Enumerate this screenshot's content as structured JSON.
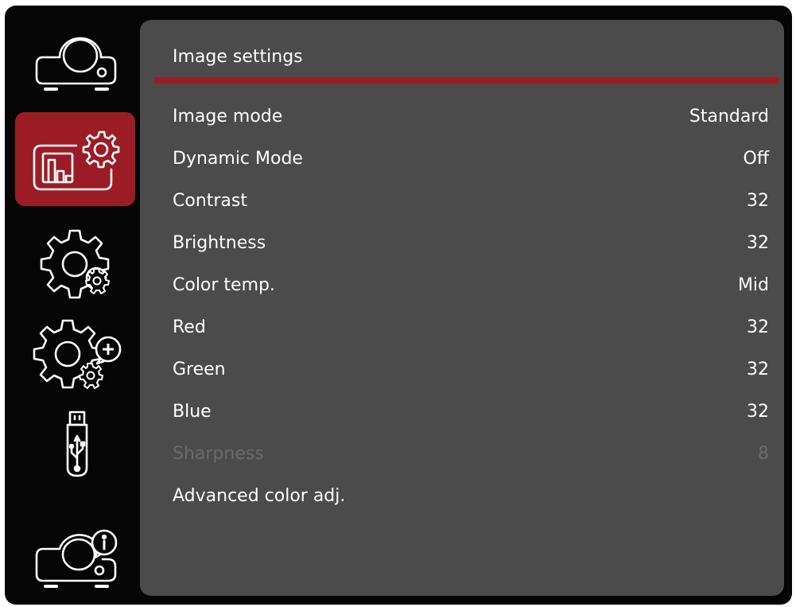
{
  "sidebar": {
    "items": [
      {
        "name": "projector-icon",
        "active": false
      },
      {
        "name": "image-settings-icon",
        "active": true
      },
      {
        "name": "settings-gear-icon",
        "active": false
      },
      {
        "name": "advanced-settings-gear-plus-icon",
        "active": false
      },
      {
        "name": "usb-icon",
        "active": false
      },
      {
        "name": "projector-info-icon",
        "active": false
      }
    ]
  },
  "panel": {
    "title": "Image settings",
    "rows": [
      {
        "label": "Image mode",
        "value": "Standard",
        "enabled": true
      },
      {
        "label": "Dynamic Mode",
        "value": "Off",
        "enabled": true
      },
      {
        "label": "Contrast",
        "value": "32",
        "enabled": true
      },
      {
        "label": "Brightness",
        "value": "32",
        "enabled": true
      },
      {
        "label": "Color temp.",
        "value": "Mid",
        "enabled": true
      },
      {
        "label": "Red",
        "value": "32",
        "enabled": true
      },
      {
        "label": "Green",
        "value": "32",
        "enabled": true
      },
      {
        "label": "Blue",
        "value": "32",
        "enabled": true
      },
      {
        "label": "Sharpness",
        "value": "8",
        "enabled": false
      },
      {
        "label": "Advanced color adj.",
        "value": "",
        "enabled": true
      }
    ]
  },
  "colors": {
    "accent": "#9c1c25",
    "panel": "#4b4b4b",
    "background": "#050505",
    "text": "#ffffff",
    "disabled_text": "#6b6b6b"
  }
}
